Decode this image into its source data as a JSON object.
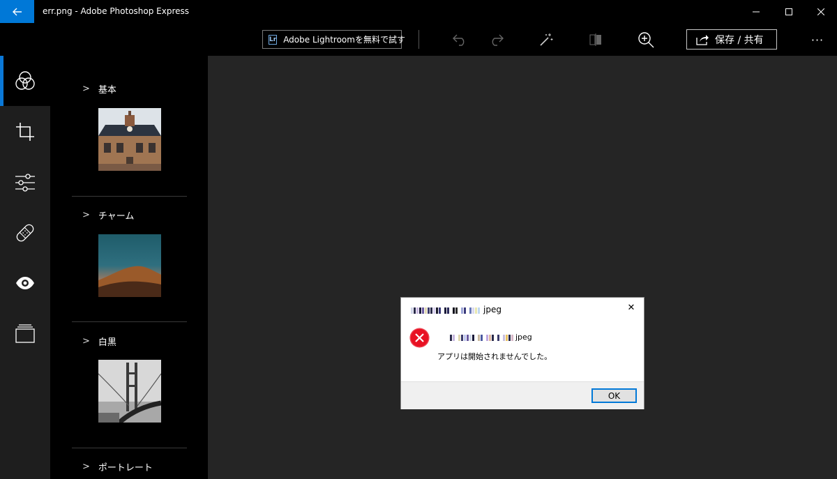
{
  "window": {
    "title": "err.png - Adobe Photoshop Express",
    "back_icon": "back-arrow-icon",
    "accent": "#0078d7"
  },
  "toolbar": {
    "lightroom_badge": "Lr",
    "lightroom_label": "Adobe Lightroomを無料で試す",
    "share_label": "保存 / 共有",
    "more_label": "···"
  },
  "rail": {
    "items": [
      {
        "icon": "looks-circles-icon",
        "active": true
      },
      {
        "icon": "crop-icon"
      },
      {
        "icon": "adjust-sliders-icon"
      },
      {
        "icon": "heal-bandage-icon"
      },
      {
        "icon": "eye-icon"
      },
      {
        "icon": "borders-layers-icon"
      }
    ]
  },
  "presets": {
    "groups": [
      {
        "label": "基本"
      },
      {
        "label": "チャーム"
      },
      {
        "label": "白黒"
      },
      {
        "label": "ポートレート"
      }
    ]
  },
  "dialog": {
    "title_suffix": "jpeg",
    "message_suffix": "jpeg",
    "message": "アプリは開始されませんでした。",
    "ok_label": "OK",
    "close_glyph": "✕"
  }
}
